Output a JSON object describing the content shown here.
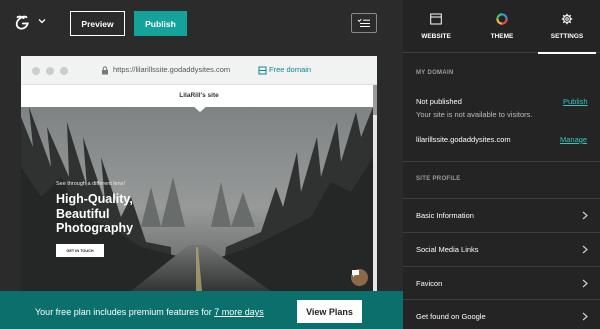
{
  "toolbar": {
    "logo_icon": "godaddy-logo-icon",
    "preview_label": "Preview",
    "publish_label": "Publish",
    "nav_icon": "list-menu-icon"
  },
  "browser": {
    "url": "https://lilarillssite.godaddysites.com",
    "free_domain_label": "Free domain",
    "site_name": "LilaRill's site"
  },
  "hero": {
    "tagline": "See through a different lens!",
    "headline": "High-Quality, Beautiful Photography",
    "cta_label": "GET IN TOUCH"
  },
  "banner": {
    "text_before": "Your free plan includes premium features for ",
    "link_text": "7 more days",
    "button_label": "View Plans",
    "background": "#0b6f6c"
  },
  "panel": {
    "tabs": [
      {
        "label": "WEBSITE",
        "icon": "browser-window-icon"
      },
      {
        "label": "THEME",
        "icon": "color-wheel-icon"
      },
      {
        "label": "SETTINGS",
        "icon": "gear-icon",
        "active": true
      }
    ],
    "my_domain": {
      "title": "MY DOMAIN",
      "status": "Not published",
      "status_sub": "Your site is not available to visitors.",
      "publish_link": "Publish",
      "domain": "lilarillssite.godaddysites.com",
      "manage_link": "Manage"
    },
    "site_profile": {
      "title": "SITE PROFILE",
      "items": [
        {
          "label": "Basic Information"
        },
        {
          "label": "Social Media Links"
        },
        {
          "label": "Favicon"
        },
        {
          "label": "Get found on Google"
        }
      ]
    }
  },
  "colors": {
    "accent": "#14a39a",
    "link": "#2fc7be",
    "panel_bg": "#242424",
    "editor_bg": "#2b2b2b"
  }
}
